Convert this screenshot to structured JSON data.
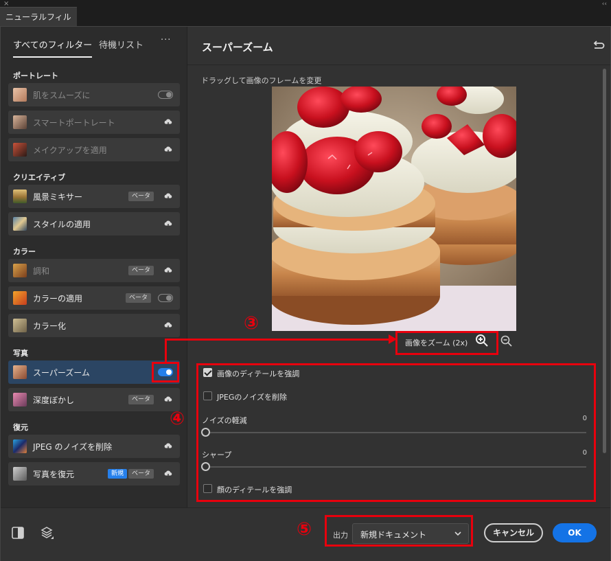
{
  "window": {
    "tab_title": "ニューラルフィルター",
    "close_glyph": "×",
    "collapse_glyph": "‹‹"
  },
  "left_panel": {
    "tabs": [
      {
        "label": "すべてのフィルター",
        "active": true
      },
      {
        "label": "待機リスト",
        "active": false
      }
    ],
    "more_label": "···",
    "categories": [
      {
        "name": "ポートレート",
        "items": [
          {
            "label": "肌をスムーズに",
            "control": "toggle-off",
            "dimmed": true
          },
          {
            "label": "スマートポートレート",
            "control": "cloud",
            "dimmed": true
          },
          {
            "label": "メイクアップを適用",
            "control": "cloud",
            "dimmed": true
          }
        ]
      },
      {
        "name": "クリエイティブ",
        "items": [
          {
            "label": "風景ミキサー",
            "badge": "ベータ",
            "control": "cloud"
          },
          {
            "label": "スタイルの適用",
            "control": "cloud"
          }
        ]
      },
      {
        "name": "カラー",
        "items": [
          {
            "label": "調和",
            "badge": "ベータ",
            "control": "cloud",
            "dimmed": true
          },
          {
            "label": "カラーの適用",
            "badge": "ベータ",
            "control": "toggle-off"
          },
          {
            "label": "カラー化",
            "control": "cloud"
          }
        ]
      },
      {
        "name": "写真",
        "items": [
          {
            "label": "スーパーズーム",
            "control": "toggle-on",
            "selected": true
          },
          {
            "label": "深度ぼかし",
            "badge": "ベータ",
            "control": "cloud"
          }
        ]
      },
      {
        "name": "復元",
        "items": [
          {
            "label": "JPEG のノイズを削除",
            "control": "cloud"
          },
          {
            "label": "写真を復元",
            "badge_new": "新規",
            "badge": "ベータ",
            "control": "cloud"
          }
        ]
      }
    ]
  },
  "right_panel": {
    "title": "スーパーズーム",
    "drag_hint": "ドラッグして画像のフレームを変更",
    "zoom_label": "画像をズーム (2x)",
    "options": [
      {
        "label": "画像のディテールを強調",
        "checked": true
      },
      {
        "label": "JPEGのノイズを削除",
        "checked": false
      }
    ],
    "sliders": [
      {
        "label": "ノイズの軽減",
        "value": "0"
      },
      {
        "label": "シャープ",
        "value": "0"
      }
    ],
    "face_option": {
      "label": "顔のディテールを強調",
      "checked": false
    }
  },
  "footer": {
    "output_label": "出力",
    "output_value": "新規ドキュメント",
    "cancel_label": "キャンセル",
    "ok_label": "OK"
  },
  "annotations": {
    "callout_3": "③",
    "callout_4": "④",
    "callout_5": "⑤"
  },
  "colors": {
    "accent": "#1473e6",
    "toggle_on": "#2680eb",
    "annotation_red": "#e8000d",
    "selected_row": "#2b4563"
  }
}
